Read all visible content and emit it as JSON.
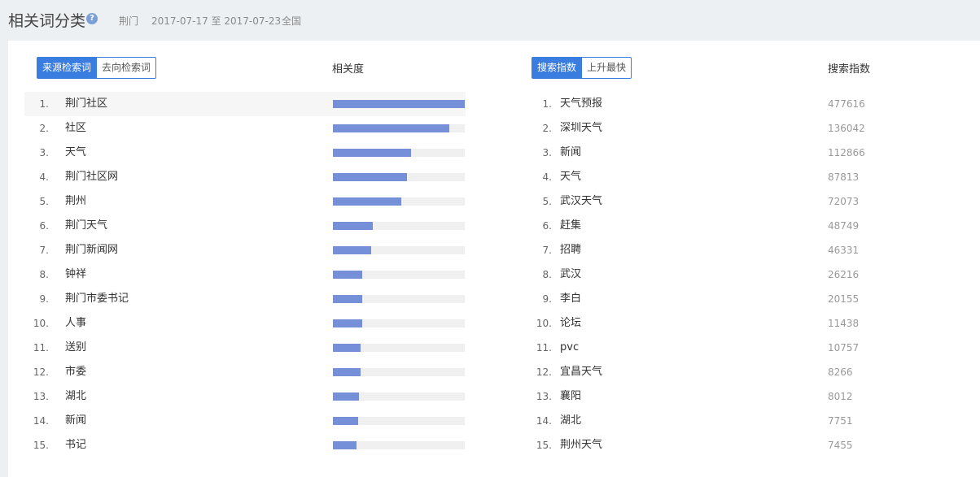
{
  "header": {
    "title": "相关词分类",
    "help_glyph": "?",
    "region": "荆门",
    "date_range": "2017-07-17 至 2017-07-23",
    "scope": "全国"
  },
  "left": {
    "tabs": [
      {
        "label": "来源检索词",
        "active": true
      },
      {
        "label": "去向检索词",
        "active": false
      }
    ],
    "column_label": "相关度",
    "bar_color": "#7590d8",
    "items": [
      {
        "rank": "1.",
        "word": "荆门社区",
        "relevance": 1.0
      },
      {
        "rank": "2.",
        "word": "社区",
        "relevance": 0.88
      },
      {
        "rank": "3.",
        "word": "天气",
        "relevance": 0.59
      },
      {
        "rank": "4.",
        "word": "荆门社区网",
        "relevance": 0.56
      },
      {
        "rank": "5.",
        "word": "荆州",
        "relevance": 0.52
      },
      {
        "rank": "6.",
        "word": "荆门天气",
        "relevance": 0.3
      },
      {
        "rank": "7.",
        "word": "荆门新闻网",
        "relevance": 0.29
      },
      {
        "rank": "8.",
        "word": "钟祥",
        "relevance": 0.22
      },
      {
        "rank": "9.",
        "word": "荆门市委书记",
        "relevance": 0.22
      },
      {
        "rank": "10.",
        "word": "人事",
        "relevance": 0.22
      },
      {
        "rank": "11.",
        "word": "送别",
        "relevance": 0.21
      },
      {
        "rank": "12.",
        "word": "市委",
        "relevance": 0.21
      },
      {
        "rank": "13.",
        "word": "湖北",
        "relevance": 0.2
      },
      {
        "rank": "14.",
        "word": "新闻",
        "relevance": 0.19
      },
      {
        "rank": "15.",
        "word": "书记",
        "relevance": 0.18
      }
    ]
  },
  "right": {
    "tabs": [
      {
        "label": "搜索指数",
        "active": true
      },
      {
        "label": "上升最快",
        "active": false
      }
    ],
    "column_label": "搜索指数",
    "items": [
      {
        "rank": "1.",
        "word": "天气预报",
        "value": "477616"
      },
      {
        "rank": "2.",
        "word": "深圳天气",
        "value": "136042"
      },
      {
        "rank": "3.",
        "word": "新闻",
        "value": "112866"
      },
      {
        "rank": "4.",
        "word": "天气",
        "value": "87813"
      },
      {
        "rank": "5.",
        "word": "武汉天气",
        "value": "72073"
      },
      {
        "rank": "6.",
        "word": "赶集",
        "value": "48749"
      },
      {
        "rank": "7.",
        "word": "招聘",
        "value": "46331"
      },
      {
        "rank": "8.",
        "word": "武汉",
        "value": "26216"
      },
      {
        "rank": "9.",
        "word": "李白",
        "value": "20155"
      },
      {
        "rank": "10.",
        "word": "论坛",
        "value": "11438"
      },
      {
        "rank": "11.",
        "word": "pvc",
        "value": "10757"
      },
      {
        "rank": "12.",
        "word": "宜昌天气",
        "value": "8266"
      },
      {
        "rank": "13.",
        "word": "襄阳",
        "value": "8012"
      },
      {
        "rank": "14.",
        "word": "湖北",
        "value": "7751"
      },
      {
        "rank": "15.",
        "word": "荆州天气",
        "value": "7455"
      }
    ]
  }
}
